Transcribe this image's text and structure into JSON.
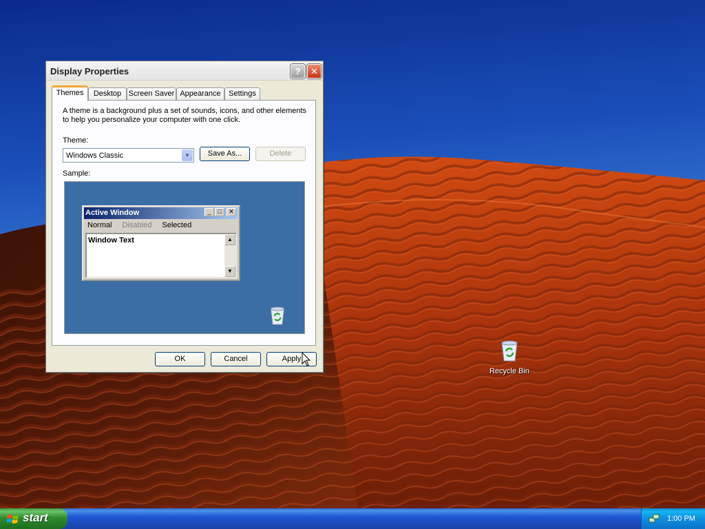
{
  "desktop": {
    "icons": [
      {
        "label": "Recycle Bin",
        "icon": "recycle-bin-icon"
      }
    ]
  },
  "dialog": {
    "title": "Display Properties",
    "help_glyph": "?",
    "close_glyph": "✕",
    "tabs": [
      {
        "label": "Themes",
        "active": true
      },
      {
        "label": "Desktop",
        "active": false
      },
      {
        "label": "Screen Saver",
        "active": false
      },
      {
        "label": "Appearance",
        "active": false
      },
      {
        "label": "Settings",
        "active": false
      }
    ],
    "description": "A theme is a background plus a set of sounds, icons, and other elements to help you personalize your computer with one click.",
    "theme_label": "Theme:",
    "theme_value": "Windows Classic",
    "save_as_label": "Save As...",
    "delete_label": "Delete",
    "sample_label": "Sample:",
    "sample_window": {
      "title": "Active Window",
      "menu": [
        "Normal",
        "Disabled",
        "Selected"
      ],
      "window_text": "Window Text"
    },
    "buttons": {
      "ok": "OK",
      "cancel": "Cancel",
      "apply": "Apply"
    }
  },
  "taskbar": {
    "start_label": "start",
    "clock": "1:00 PM"
  },
  "colors": {
    "start_button": "#2f8b2f",
    "taskbar": "#245edb",
    "tray": "#0f8ee1",
    "sample_bg": "#3a6ea5",
    "active_tab_accent": "#f4a73a"
  }
}
